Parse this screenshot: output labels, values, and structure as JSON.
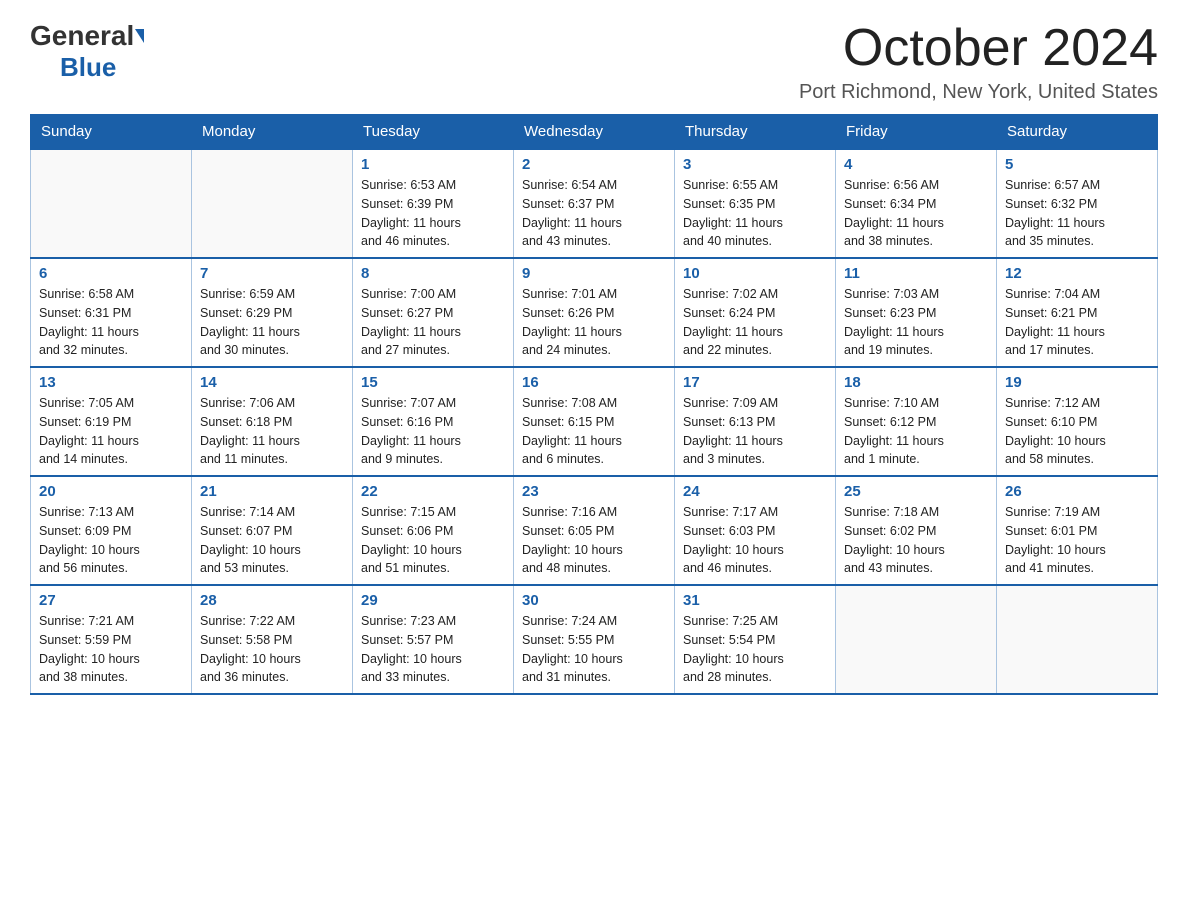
{
  "header": {
    "logo_general": "General",
    "logo_blue": "Blue",
    "month_title": "October 2024",
    "location": "Port Richmond, New York, United States"
  },
  "days_of_week": [
    "Sunday",
    "Monday",
    "Tuesday",
    "Wednesday",
    "Thursday",
    "Friday",
    "Saturday"
  ],
  "weeks": [
    [
      {
        "day": "",
        "info": ""
      },
      {
        "day": "",
        "info": ""
      },
      {
        "day": "1",
        "info": "Sunrise: 6:53 AM\nSunset: 6:39 PM\nDaylight: 11 hours\nand 46 minutes."
      },
      {
        "day": "2",
        "info": "Sunrise: 6:54 AM\nSunset: 6:37 PM\nDaylight: 11 hours\nand 43 minutes."
      },
      {
        "day": "3",
        "info": "Sunrise: 6:55 AM\nSunset: 6:35 PM\nDaylight: 11 hours\nand 40 minutes."
      },
      {
        "day": "4",
        "info": "Sunrise: 6:56 AM\nSunset: 6:34 PM\nDaylight: 11 hours\nand 38 minutes."
      },
      {
        "day": "5",
        "info": "Sunrise: 6:57 AM\nSunset: 6:32 PM\nDaylight: 11 hours\nand 35 minutes."
      }
    ],
    [
      {
        "day": "6",
        "info": "Sunrise: 6:58 AM\nSunset: 6:31 PM\nDaylight: 11 hours\nand 32 minutes."
      },
      {
        "day": "7",
        "info": "Sunrise: 6:59 AM\nSunset: 6:29 PM\nDaylight: 11 hours\nand 30 minutes."
      },
      {
        "day": "8",
        "info": "Sunrise: 7:00 AM\nSunset: 6:27 PM\nDaylight: 11 hours\nand 27 minutes."
      },
      {
        "day": "9",
        "info": "Sunrise: 7:01 AM\nSunset: 6:26 PM\nDaylight: 11 hours\nand 24 minutes."
      },
      {
        "day": "10",
        "info": "Sunrise: 7:02 AM\nSunset: 6:24 PM\nDaylight: 11 hours\nand 22 minutes."
      },
      {
        "day": "11",
        "info": "Sunrise: 7:03 AM\nSunset: 6:23 PM\nDaylight: 11 hours\nand 19 minutes."
      },
      {
        "day": "12",
        "info": "Sunrise: 7:04 AM\nSunset: 6:21 PM\nDaylight: 11 hours\nand 17 minutes."
      }
    ],
    [
      {
        "day": "13",
        "info": "Sunrise: 7:05 AM\nSunset: 6:19 PM\nDaylight: 11 hours\nand 14 minutes."
      },
      {
        "day": "14",
        "info": "Sunrise: 7:06 AM\nSunset: 6:18 PM\nDaylight: 11 hours\nand 11 minutes."
      },
      {
        "day": "15",
        "info": "Sunrise: 7:07 AM\nSunset: 6:16 PM\nDaylight: 11 hours\nand 9 minutes."
      },
      {
        "day": "16",
        "info": "Sunrise: 7:08 AM\nSunset: 6:15 PM\nDaylight: 11 hours\nand 6 minutes."
      },
      {
        "day": "17",
        "info": "Sunrise: 7:09 AM\nSunset: 6:13 PM\nDaylight: 11 hours\nand 3 minutes."
      },
      {
        "day": "18",
        "info": "Sunrise: 7:10 AM\nSunset: 6:12 PM\nDaylight: 11 hours\nand 1 minute."
      },
      {
        "day": "19",
        "info": "Sunrise: 7:12 AM\nSunset: 6:10 PM\nDaylight: 10 hours\nand 58 minutes."
      }
    ],
    [
      {
        "day": "20",
        "info": "Sunrise: 7:13 AM\nSunset: 6:09 PM\nDaylight: 10 hours\nand 56 minutes."
      },
      {
        "day": "21",
        "info": "Sunrise: 7:14 AM\nSunset: 6:07 PM\nDaylight: 10 hours\nand 53 minutes."
      },
      {
        "day": "22",
        "info": "Sunrise: 7:15 AM\nSunset: 6:06 PM\nDaylight: 10 hours\nand 51 minutes."
      },
      {
        "day": "23",
        "info": "Sunrise: 7:16 AM\nSunset: 6:05 PM\nDaylight: 10 hours\nand 48 minutes."
      },
      {
        "day": "24",
        "info": "Sunrise: 7:17 AM\nSunset: 6:03 PM\nDaylight: 10 hours\nand 46 minutes."
      },
      {
        "day": "25",
        "info": "Sunrise: 7:18 AM\nSunset: 6:02 PM\nDaylight: 10 hours\nand 43 minutes."
      },
      {
        "day": "26",
        "info": "Sunrise: 7:19 AM\nSunset: 6:01 PM\nDaylight: 10 hours\nand 41 minutes."
      }
    ],
    [
      {
        "day": "27",
        "info": "Sunrise: 7:21 AM\nSunset: 5:59 PM\nDaylight: 10 hours\nand 38 minutes."
      },
      {
        "day": "28",
        "info": "Sunrise: 7:22 AM\nSunset: 5:58 PM\nDaylight: 10 hours\nand 36 minutes."
      },
      {
        "day": "29",
        "info": "Sunrise: 7:23 AM\nSunset: 5:57 PM\nDaylight: 10 hours\nand 33 minutes."
      },
      {
        "day": "30",
        "info": "Sunrise: 7:24 AM\nSunset: 5:55 PM\nDaylight: 10 hours\nand 31 minutes."
      },
      {
        "day": "31",
        "info": "Sunrise: 7:25 AM\nSunset: 5:54 PM\nDaylight: 10 hours\nand 28 minutes."
      },
      {
        "day": "",
        "info": ""
      },
      {
        "day": "",
        "info": ""
      }
    ]
  ],
  "colors": {
    "header_bg": "#1a5fa8",
    "header_text": "#ffffff",
    "day_number": "#1a5fa8",
    "border": "#aac4e0",
    "row_border": "#1a5fa8"
  }
}
